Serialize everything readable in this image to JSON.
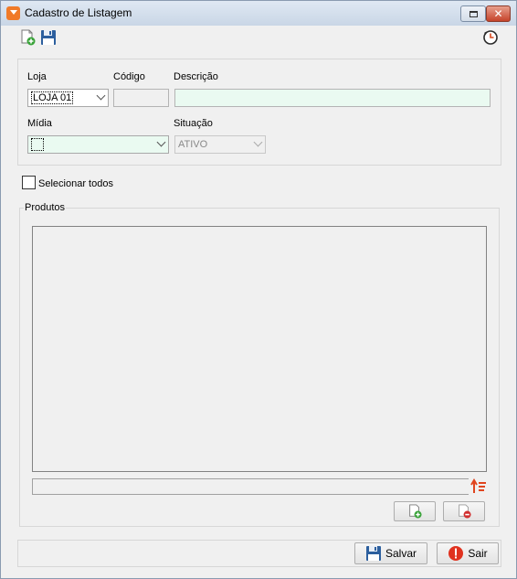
{
  "window": {
    "title": "Cadastro de Listagem"
  },
  "toolbar": {
    "icons": [
      "new-document-icon",
      "save-icon",
      "history-icon"
    ]
  },
  "form": {
    "loja": {
      "label": "Loja",
      "value": "LOJA 01"
    },
    "codigo": {
      "label": "Código",
      "value": ""
    },
    "descricao": {
      "label": "Descrição",
      "value": ""
    },
    "midia": {
      "label": "Mídia",
      "value": ""
    },
    "situacao": {
      "label": "Situação",
      "value": "ATIVO"
    }
  },
  "select_all": {
    "label": "Selecionar todos",
    "checked": false
  },
  "produtos": {
    "label": "Produtos",
    "items": []
  },
  "footer": {
    "save_label": "Salvar",
    "exit_label": "Sair"
  },
  "colors": {
    "field_highlight": "#eafaf1",
    "accent_orange": "#f07a28",
    "close_red": "#c5432a"
  }
}
